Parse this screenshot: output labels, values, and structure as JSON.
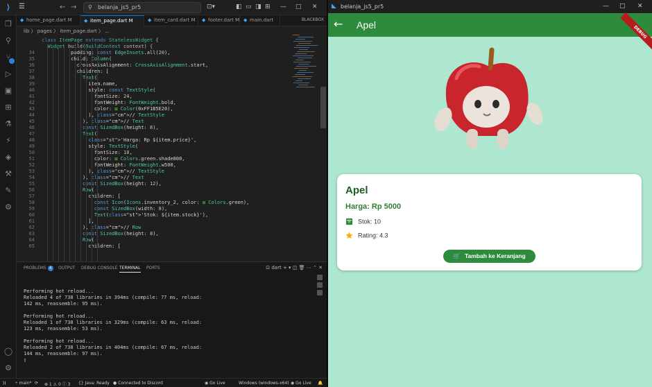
{
  "vscode": {
    "search": "belanja_js5_pr5",
    "tabs": [
      {
        "label": "home_page.dart M"
      },
      {
        "label": "item_page.dart M",
        "active": true
      },
      {
        "label": "item_card.dart M"
      },
      {
        "label": "footer.dart M"
      },
      {
        "label": "main.dart"
      }
    ],
    "blackbox": "BLACKBOX",
    "breadcrumb": "lib 〉 pages 〉 item_page.dart 〉 ...",
    "code_lines": [
      {
        "n": "",
        "t": "class ItemPage extends StatelessWidget {"
      },
      {
        "n": "",
        "t": "  Widget build(BuildContext context) {"
      },
      {
        "n": "34",
        "t": "          padding: const EdgeInsets.all(20),"
      },
      {
        "n": "35",
        "t": "          child: Column("
      },
      {
        "n": "36",
        "t": "            crossAxisAlignment: CrossAxisAlignment.start,"
      },
      {
        "n": "37",
        "t": "            children: ["
      },
      {
        "n": "38",
        "t": "              Text("
      },
      {
        "n": "39",
        "t": "                item.name,"
      },
      {
        "n": "40",
        "t": "                style: const TextStyle("
      },
      {
        "n": "41",
        "t": "                  fontSize: 24,"
      },
      {
        "n": "42",
        "t": "                  fontWeight: FontWeight.bold,"
      },
      {
        "n": "43",
        "t": "                  color: ■ Color(0xFF1B5E20),"
      },
      {
        "n": "44",
        "t": "                ), // TextStyle"
      },
      {
        "n": "45",
        "t": "              ), // Text"
      },
      {
        "n": "46",
        "t": "              const SizedBox(height: 8),"
      },
      {
        "n": "47",
        "t": "              Text("
      },
      {
        "n": "48",
        "t": "                'Harga: Rp ${item.price}',"
      },
      {
        "n": "49",
        "t": "                style: TextStyle("
      },
      {
        "n": "50",
        "t": "                  fontSize: 18,"
      },
      {
        "n": "51",
        "t": "                  color: ■ Colors.green.shade800,"
      },
      {
        "n": "52",
        "t": "                  fontWeight: FontWeight.w500,"
      },
      {
        "n": "53",
        "t": "                ), // TextStyle"
      },
      {
        "n": "54",
        "t": "              ), // Text"
      },
      {
        "n": "55",
        "t": "              const SizedBox(height: 12),"
      },
      {
        "n": "56",
        "t": "              Row("
      },
      {
        "n": "57",
        "t": "                children: ["
      },
      {
        "n": "58",
        "t": "                  const Icon(Icons.inventory_2, color: ■ Colors.green),"
      },
      {
        "n": "59",
        "t": "                  const SizedBox(width: 8),"
      },
      {
        "n": "60",
        "t": "                  Text('Stok: ${item.stock}'),"
      },
      {
        "n": "61",
        "t": "                ],"
      },
      {
        "n": "62",
        "t": "              ), // Row"
      },
      {
        "n": "63",
        "t": "              const SizedBox(height: 8),"
      },
      {
        "n": "64",
        "t": "              Row("
      },
      {
        "n": "65",
        "t": "                children: ["
      }
    ],
    "panel_tabs": {
      "problems": "PROBLEMS",
      "problems_count": "4",
      "output": "OUTPUT",
      "debug": "DEBUG CONSOLE",
      "terminal": "TERMINAL",
      "ports": "PORTS"
    },
    "panel_tool_label": "dart",
    "terminal_text": "Performing hot reload...\nReloaded 4 of 738 libraries in 394ms (compile: 77 ms, reload:\n142 ms, reassemble: 95 ms).\n\nPerforming hot reload...\nReloaded 1 of 738 libraries in 329ms (compile: 63 ms, reload:\n123 ms, reassemble: 53 ms).\n\nPerforming hot reload...\nReloaded 2 of 738 libraries in 404ms (compile: 67 ms, reload:\n144 ms, reassemble: 97 ms).\n▯",
    "status": {
      "branch": "main*",
      "sync": "⟳",
      "problems": "⊗ 1 ⚠ 0 ⓘ 3",
      "java": "Java: Ready",
      "discord": "Connected to Discord",
      "golive1": "Go Live",
      "windows": "Windows (windows-x64)",
      "golive2": "Go Live"
    }
  },
  "flutter": {
    "window_title": "belanja_js5_pr5",
    "appbar_title": "Apel",
    "debug_banner": "DEBUG",
    "item": {
      "name": "Apel",
      "price": "Harga: Rp 5000",
      "stock": "Stok: 10",
      "rating": "Rating: 4.3"
    },
    "button": "Tambah ke Keranjang",
    "colors": {
      "appbar": "#2e8b3d",
      "background": "#aee7d0",
      "title": "#1b5e20",
      "price": "#2e7d32"
    }
  }
}
